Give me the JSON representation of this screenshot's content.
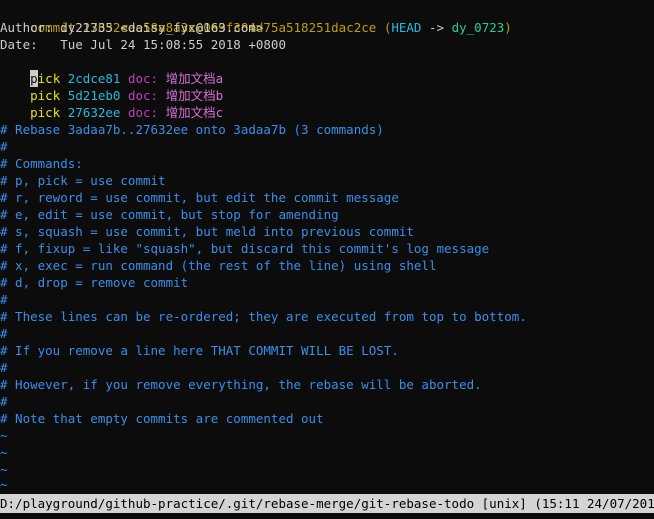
{
  "commit": {
    "label": "commit",
    "hash": "27632eee58a8a3c60e9f384d75a518251dac2ce",
    "head_open": "(",
    "head": "HEAD",
    "arrow": "->",
    "branch": "dy_0723",
    "head_close": ")"
  },
  "author_line": "Author: dy21335 <daisy_fyx@163.com>",
  "date_line": "Date:   Tue Jul 24 15:08:55 2018 +0800",
  "picks": [
    {
      "cmd": "pick",
      "hash": "2cdce81",
      "type": "doc:",
      "msg": "增加文档a"
    },
    {
      "cmd": "pick",
      "hash": "5d21eb0",
      "type": "doc:",
      "msg": "增加文档b"
    },
    {
      "cmd": "pick",
      "hash": "27632ee",
      "type": "doc:",
      "msg": "增加文档c"
    }
  ],
  "comments": [
    "# Rebase 3adaa7b..27632ee onto 3adaa7b (3 commands)",
    "#",
    "# Commands:",
    "# p, pick = use commit",
    "# r, reword = use commit, but edit the commit message",
    "# e, edit = use commit, but stop for amending",
    "# s, squash = use commit, but meld into previous commit",
    "# f, fixup = like \"squash\", but discard this commit's log message",
    "# x, exec = run command (the rest of the line) using shell",
    "# d, drop = remove commit",
    "#",
    "# These lines can be re-ordered; they are executed from top to bottom.",
    "#",
    "# If you remove a line here THAT COMMIT WILL BE LOST.",
    "#",
    "# However, if you remove everything, the rebase will be aborted.",
    "#",
    "# Note that empty commits are commented out"
  ],
  "tildes": [
    "~",
    "~",
    "~",
    "~"
  ],
  "status_bar": "D:/playground/github-practice/.git/rebase-merge/git-rebase-todo [unix] (15:11 24/07/2018)",
  "colors": {
    "background": "#0c0c0c",
    "commit_yellow": "#c0a000",
    "head_cyan": "#29b8db",
    "branch_green": "#23d18b",
    "pick_yellow": "#e5e510",
    "doc_magenta": "#bc3fbc",
    "comment_blue": "#3b8eea",
    "status_bar_bg": "#d4d4d4"
  }
}
